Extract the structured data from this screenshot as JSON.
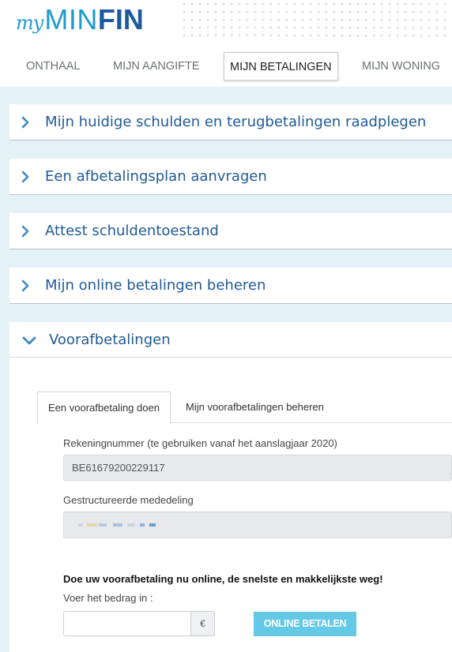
{
  "logo": {
    "my": "my",
    "min": "MIN",
    "fin": "FIN"
  },
  "nav": {
    "items": [
      {
        "label": "ONTHAAL"
      },
      {
        "label": "MIJN AANGIFTE"
      },
      {
        "label": "MIJN BETALINGEN"
      },
      {
        "label": "MIJN WONING"
      }
    ],
    "active_index": 2
  },
  "accordion": {
    "collapsed": [
      {
        "title": "Mijn huidige schulden en terugbetalingen raadplegen",
        "icon": "chevron-right-icon"
      },
      {
        "title": "Een afbetalingsplan aanvragen",
        "icon": "chevron-right-icon"
      },
      {
        "title": "Attest schuldentoestand",
        "icon": "chevron-right-icon"
      },
      {
        "title": "Mijn online betalingen beheren",
        "icon": "chevron-right-icon"
      }
    ],
    "expanded": {
      "title": "Voorafbetalingen",
      "icon": "chevron-down-icon",
      "tabs": [
        {
          "label": "Een voorafbetaling doen"
        },
        {
          "label": "Mijn voorafbetalingen beheren"
        }
      ],
      "account_label": "Rekeningnummer (te gebruiken vanaf het aanslagjaar 2020)",
      "account_value": "BE61679200229117",
      "structured_label": "Gestructureerde mededeling",
      "promo": "Doe uw voorafbetaling nu online, de snelste en makkelijkste weg!",
      "amount_label": "Voer het bedrag in :",
      "amount_value": "",
      "currency": "€",
      "pay_button": "ONLINE BETALEN"
    }
  },
  "colors": {
    "brand_light": "#1d9bd0",
    "brand_dark": "#1d5a9e",
    "panel_title": "#215a96",
    "background": "#e4f2f8",
    "pay_button": "#63c9e6"
  }
}
